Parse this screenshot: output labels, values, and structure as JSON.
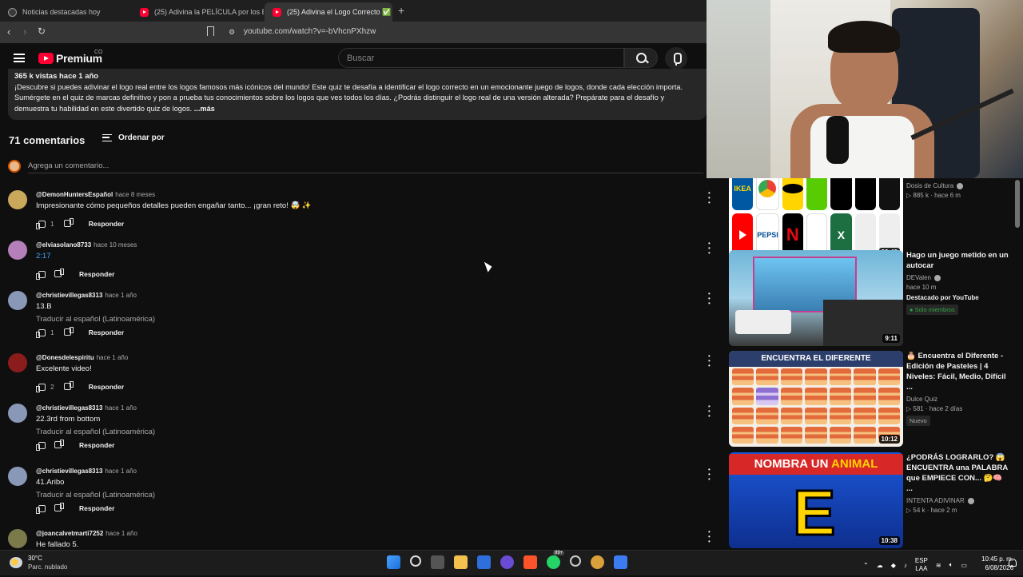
{
  "browser": {
    "tabs": [
      {
        "title": "Noticias destacadas hoy",
        "active": false
      },
      {
        "title": "(25) Adivina la PELÍCULA por los EMO",
        "active": false
      },
      {
        "title": "(25) Adivina el Logo Correcto ✅",
        "active": true
      }
    ],
    "url": "youtube.com/watch?v=-bVhcnPXhzw"
  },
  "header": {
    "brand": "Premium",
    "country": "CO",
    "search_placeholder": "Buscar"
  },
  "description": {
    "meta": "365 k vistas  hace 1 año",
    "text": "¡Descubre si puedes adivinar el logo real entre los logos famosos más icónicos del mundo! Este quiz te desafía a identificar el logo correcto en un emocionante juego de logos, donde cada elección importa. Sumérgete en el quiz de marcas definitivo y pon a prueba tus conocimientos sobre los logos que ves todos los días. ¿Podrás distinguir el logo real de una versión alterada? Prepárate para el desafío y demuestra tu habilidad en este divertido quiz de logos.",
    "more": "...más"
  },
  "comments_header": {
    "count": "71 comentarios",
    "sort_label": "Ordenar por",
    "add_placeholder": "Agrega un comentario..."
  },
  "comments": [
    {
      "user": "@DemonHuntersEspañol",
      "time": "hace 8 meses",
      "text": "Impresionante cómo pequeños detalles pueden engañar tanto... ¡gran reto! 🤯 ✨",
      "likes": "1",
      "translate": "",
      "link": false,
      "avatar_color": "#c9a85c"
    },
    {
      "user": "@elviasolano8733",
      "time": "hace 10 meses",
      "text": "2:17",
      "likes": "",
      "translate": "",
      "link": true,
      "avatar_color": "#b57fb9"
    },
    {
      "user": "@christievillegas8313",
      "time": "hace 1 año",
      "text": "13.B",
      "likes": "1",
      "translate": "Traducir al español (Latinoamérica)",
      "link": false,
      "avatar_color": "#8a98b8"
    },
    {
      "user": "@Donesdelespiritu",
      "time": "hace 1 año",
      "text": "Excelente video!",
      "likes": "2",
      "translate": "",
      "link": false,
      "avatar_color": "#8b1c1c"
    },
    {
      "user": "@christievillegas8313",
      "time": "hace 1 año",
      "text": "22.3rd from bottom",
      "likes": "",
      "translate": "Traducir al español (Latinoamérica)",
      "link": false,
      "avatar_color": "#8a98b8"
    },
    {
      "user": "@christievillegas8313",
      "time": "hace 1 año",
      "text": "41.Aribo",
      "likes": "",
      "translate": "Traducir al español (Latinoamérica)",
      "link": false,
      "avatar_color": "#8a98b8"
    },
    {
      "user": "@joancalvetmarti7252",
      "time": "hace 1 año",
      "text": "He fallado 5.",
      "likes": "",
      "translate": "",
      "link": false,
      "avatar_color": "#7a7a4a"
    }
  ],
  "reply_label": "Responder",
  "recommendations": [
    {
      "title": "",
      "channel": "Dosis de Cultura",
      "verified": true,
      "views": "885 k",
      "time": "hace 6 m",
      "duration": "23:42",
      "featured": "",
      "badge": ""
    },
    {
      "title": "Hago un juego metido en un autocar",
      "channel": "DEValen",
      "verified": true,
      "views": "",
      "time": "hace 10 m",
      "duration": "9:11",
      "featured": "Destacado por YouTube",
      "badge": "Solo miembros"
    },
    {
      "title": "🎂 Encuentra el Diferente - Edición de Pasteles | 4 Niveles: Fácil, Medio, Difícil ...",
      "channel": "Dulce Quiz",
      "verified": false,
      "views": "581",
      "time": "hace 2 días",
      "duration": "10:12",
      "featured": "",
      "badge": "Nuevo"
    },
    {
      "title": "¿PODRÁS LOGRARLO? 😱 ENCUENTRA una PALABRA que EMPIECE CON... 🤔🧠 ...",
      "channel": "INTENTA ADIVINAR",
      "verified": true,
      "views": "54 k",
      "time": "hace 2 m",
      "duration": "10:38",
      "featured": "",
      "badge": ""
    }
  ],
  "thumb_text": {
    "logos": [
      "IKEA",
      "",
      "",
      "",
      "",
      "",
      "",
      "",
      "PEPSI",
      "",
      "",
      "X"
    ],
    "find_different": "ENCUENTRA EL DIFERENTE",
    "name_animal_a": "NOMBRA UN ",
    "name_animal_b": "ANIMAL",
    "letter": "E"
  },
  "taskbar": {
    "temp": "30°C",
    "weather": "Parc. nublado",
    "lang1": "ESP",
    "lang2": "LAA",
    "time": "10:45 p. m.",
    "date": "6/08/2026",
    "whatsapp_badge": "99+"
  }
}
